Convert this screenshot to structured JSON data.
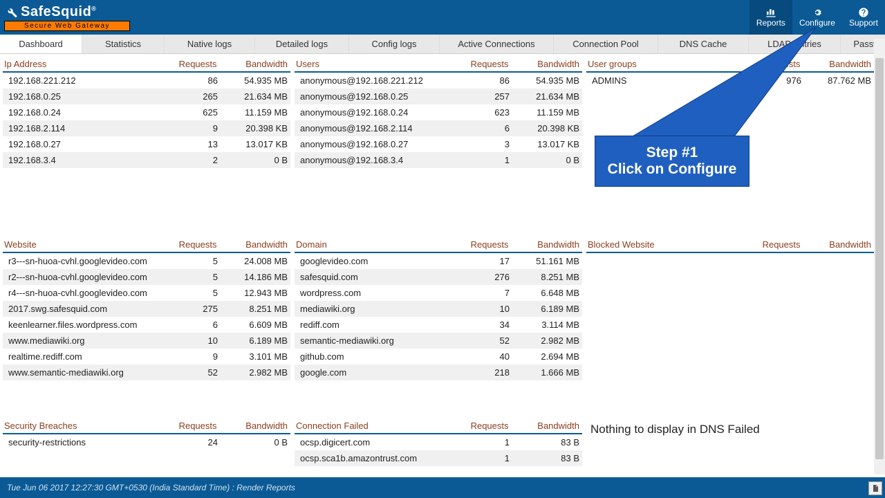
{
  "brand": {
    "name": "SafeSquid",
    "reg": "®",
    "tagline": "Secure Web Gateway"
  },
  "nav": {
    "reports": "Reports",
    "configure": "Configure",
    "support": "Support",
    "active": "reports"
  },
  "tabs": [
    "Dashboard",
    "Statistics",
    "Native logs",
    "Detailed logs",
    "Config logs",
    "Active Connections",
    "Connection Pool",
    "DNS Cache",
    "LDAP Entries",
    "Password Cache"
  ],
  "tabs_active": 0,
  "tab_widths": [
    118,
    118,
    130,
    135,
    130,
    164,
    150,
    130,
    132,
    135
  ],
  "panels": {
    "ip": {
      "title": "Ip Address",
      "col2": "Requests",
      "col3": "Bandwidth",
      "rows": [
        [
          "192.168.221.212",
          "86",
          "54.935 MB"
        ],
        [
          "192.168.0.25",
          "265",
          "21.634 MB"
        ],
        [
          "192.168.0.24",
          "625",
          "11.159 MB"
        ],
        [
          "192.168.2.114",
          "9",
          "20.398 KB"
        ],
        [
          "192.168.0.27",
          "13",
          "13.017 KB"
        ],
        [
          "192.168.3.4",
          "2",
          "0 B"
        ]
      ]
    },
    "users": {
      "title": "Users",
      "col2": "Requests",
      "col3": "Bandwidth",
      "rows": [
        [
          "anonymous@192.168.221.212",
          "86",
          "54.935 MB"
        ],
        [
          "anonymous@192.168.0.25",
          "257",
          "21.634 MB"
        ],
        [
          "anonymous@192.168.0.24",
          "623",
          "11.159 MB"
        ],
        [
          "anonymous@192.168.2.114",
          "6",
          "20.398 KB"
        ],
        [
          "anonymous@192.168.0.27",
          "3",
          "13.017 KB"
        ],
        [
          "anonymous@192.168.3.4",
          "1",
          "0 B"
        ]
      ]
    },
    "groups": {
      "title": "User groups",
      "col2": "Requests",
      "col3": "Bandwidth",
      "rows": [
        [
          "ADMINS",
          "976",
          "87.762 MB"
        ]
      ]
    },
    "website": {
      "title": "Website",
      "col2": "Requests",
      "col3": "Bandwidth",
      "rows": [
        [
          "r3---sn-huoa-cvhl.googlevideo.com",
          "5",
          "24.008 MB"
        ],
        [
          "r2---sn-huoa-cvhl.googlevideo.com",
          "5",
          "14.186 MB"
        ],
        [
          "r4---sn-huoa-cvhl.googlevideo.com",
          "5",
          "12.943 MB"
        ],
        [
          "2017.swg.safesquid.com",
          "275",
          "8.251 MB"
        ],
        [
          "keenlearner.files.wordpress.com",
          "6",
          "6.609 MB"
        ],
        [
          "www.mediawiki.org",
          "10",
          "6.189 MB"
        ],
        [
          "realtime.rediff.com",
          "9",
          "3.101 MB"
        ],
        [
          "www.semantic-mediawiki.org",
          "52",
          "2.982 MB"
        ]
      ]
    },
    "domain": {
      "title": "Domain",
      "col2": "Requests",
      "col3": "Bandwidth",
      "rows": [
        [
          "googlevideo.com",
          "17",
          "51.161 MB"
        ],
        [
          "safesquid.com",
          "276",
          "8.251 MB"
        ],
        [
          "wordpress.com",
          "7",
          "6.648 MB"
        ],
        [
          "mediawiki.org",
          "10",
          "6.189 MB"
        ],
        [
          "rediff.com",
          "34",
          "3.114 MB"
        ],
        [
          "semantic-mediawiki.org",
          "52",
          "2.982 MB"
        ],
        [
          "github.com",
          "40",
          "2.694 MB"
        ],
        [
          "google.com",
          "218",
          "1.666 MB"
        ]
      ]
    },
    "blocked": {
      "title": "Blocked Website",
      "col2": "Requests",
      "col3": "Bandwidth",
      "rows": []
    },
    "security": {
      "title": "Security Breaches",
      "col2": "Requests",
      "col3": "Bandwidth",
      "rows": [
        [
          "security-restrictions",
          "24",
          "0 B"
        ]
      ]
    },
    "connfail": {
      "title": "Connection Failed",
      "col2": "Requests",
      "col3": "Bandwidth",
      "rows": [
        [
          "ocsp.digicert.com",
          "1",
          "83 B"
        ],
        [
          "ocsp.sca1b.amazontrust.com",
          "1",
          "83 B"
        ]
      ]
    },
    "dnsfail": {
      "title": "",
      "empty": "Nothing to display in DNS Failed"
    }
  },
  "callout": {
    "line1": "Step #1",
    "line2": "Click on Configure"
  },
  "footer": "Tue Jun 06 2017 12:27:30 GMT+0530 (India Standard Time) : Render Reports"
}
